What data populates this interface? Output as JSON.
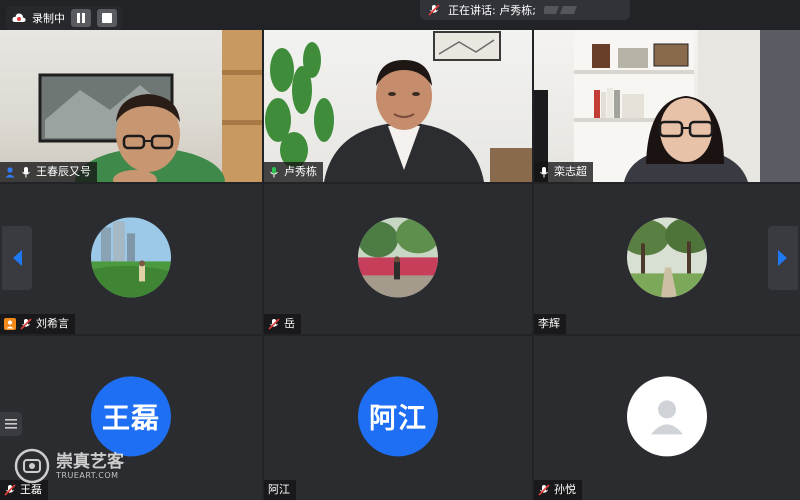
{
  "recording": {
    "label": "录制中"
  },
  "speaking": {
    "prefix": "正在讲话: ",
    "name": "卢秀栋;"
  },
  "participants": [
    {
      "name": "王春辰又号"
    },
    {
      "name": "卢秀栋"
    },
    {
      "name": "栾志超"
    },
    {
      "name": "刘希言"
    },
    {
      "name": "岳"
    },
    {
      "name": "李辉"
    },
    {
      "name": "王磊",
      "initials": "王磊"
    },
    {
      "name": "阿江",
      "initials": "阿江"
    },
    {
      "name": "孙悦"
    }
  ],
  "watermark": {
    "title": "崇真艺客",
    "subtitle": "TRUEART.COM"
  },
  "colors": {
    "accent_blue": "#1e6ff3",
    "active_border": "#2ec24e",
    "arrow_blue": "#1e78f0"
  }
}
